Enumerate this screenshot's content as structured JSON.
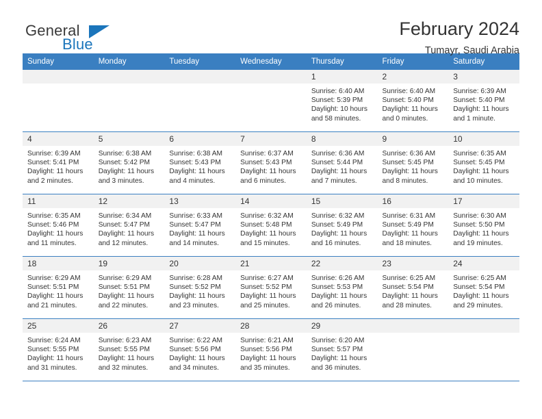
{
  "logo": {
    "word_top": "General",
    "word_bottom": "Blue",
    "accent_color": "#1b75bb",
    "triangle_icon": "triangle-icon"
  },
  "header": {
    "title": "February 2024",
    "subtitle": "Tumayr, Saudi Arabia"
  },
  "theme": {
    "header_band": "#3a7fc1",
    "daynum_band": "#f1f1f1",
    "text": "#333333"
  },
  "weekdays": [
    "Sunday",
    "Monday",
    "Tuesday",
    "Wednesday",
    "Thursday",
    "Friday",
    "Saturday"
  ],
  "weeks": [
    [
      {
        "day": "",
        "empty": true
      },
      {
        "day": "",
        "empty": true
      },
      {
        "day": "",
        "empty": true
      },
      {
        "day": "",
        "empty": true
      },
      {
        "day": "1",
        "sunrise": "Sunrise: 6:40 AM",
        "sunset": "Sunset: 5:39 PM",
        "daylight": "Daylight: 10 hours and 58 minutes."
      },
      {
        "day": "2",
        "sunrise": "Sunrise: 6:40 AM",
        "sunset": "Sunset: 5:40 PM",
        "daylight": "Daylight: 11 hours and 0 minutes."
      },
      {
        "day": "3",
        "sunrise": "Sunrise: 6:39 AM",
        "sunset": "Sunset: 5:40 PM",
        "daylight": "Daylight: 11 hours and 1 minute."
      }
    ],
    [
      {
        "day": "4",
        "sunrise": "Sunrise: 6:39 AM",
        "sunset": "Sunset: 5:41 PM",
        "daylight": "Daylight: 11 hours and 2 minutes."
      },
      {
        "day": "5",
        "sunrise": "Sunrise: 6:38 AM",
        "sunset": "Sunset: 5:42 PM",
        "daylight": "Daylight: 11 hours and 3 minutes."
      },
      {
        "day": "6",
        "sunrise": "Sunrise: 6:38 AM",
        "sunset": "Sunset: 5:43 PM",
        "daylight": "Daylight: 11 hours and 4 minutes."
      },
      {
        "day": "7",
        "sunrise": "Sunrise: 6:37 AM",
        "sunset": "Sunset: 5:43 PM",
        "daylight": "Daylight: 11 hours and 6 minutes."
      },
      {
        "day": "8",
        "sunrise": "Sunrise: 6:36 AM",
        "sunset": "Sunset: 5:44 PM",
        "daylight": "Daylight: 11 hours and 7 minutes."
      },
      {
        "day": "9",
        "sunrise": "Sunrise: 6:36 AM",
        "sunset": "Sunset: 5:45 PM",
        "daylight": "Daylight: 11 hours and 8 minutes."
      },
      {
        "day": "10",
        "sunrise": "Sunrise: 6:35 AM",
        "sunset": "Sunset: 5:45 PM",
        "daylight": "Daylight: 11 hours and 10 minutes."
      }
    ],
    [
      {
        "day": "11",
        "sunrise": "Sunrise: 6:35 AM",
        "sunset": "Sunset: 5:46 PM",
        "daylight": "Daylight: 11 hours and 11 minutes."
      },
      {
        "day": "12",
        "sunrise": "Sunrise: 6:34 AM",
        "sunset": "Sunset: 5:47 PM",
        "daylight": "Daylight: 11 hours and 12 minutes."
      },
      {
        "day": "13",
        "sunrise": "Sunrise: 6:33 AM",
        "sunset": "Sunset: 5:47 PM",
        "daylight": "Daylight: 11 hours and 14 minutes."
      },
      {
        "day": "14",
        "sunrise": "Sunrise: 6:32 AM",
        "sunset": "Sunset: 5:48 PM",
        "daylight": "Daylight: 11 hours and 15 minutes."
      },
      {
        "day": "15",
        "sunrise": "Sunrise: 6:32 AM",
        "sunset": "Sunset: 5:49 PM",
        "daylight": "Daylight: 11 hours and 16 minutes."
      },
      {
        "day": "16",
        "sunrise": "Sunrise: 6:31 AM",
        "sunset": "Sunset: 5:49 PM",
        "daylight": "Daylight: 11 hours and 18 minutes."
      },
      {
        "day": "17",
        "sunrise": "Sunrise: 6:30 AM",
        "sunset": "Sunset: 5:50 PM",
        "daylight": "Daylight: 11 hours and 19 minutes."
      }
    ],
    [
      {
        "day": "18",
        "sunrise": "Sunrise: 6:29 AM",
        "sunset": "Sunset: 5:51 PM",
        "daylight": "Daylight: 11 hours and 21 minutes."
      },
      {
        "day": "19",
        "sunrise": "Sunrise: 6:29 AM",
        "sunset": "Sunset: 5:51 PM",
        "daylight": "Daylight: 11 hours and 22 minutes."
      },
      {
        "day": "20",
        "sunrise": "Sunrise: 6:28 AM",
        "sunset": "Sunset: 5:52 PM",
        "daylight": "Daylight: 11 hours and 23 minutes."
      },
      {
        "day": "21",
        "sunrise": "Sunrise: 6:27 AM",
        "sunset": "Sunset: 5:52 PM",
        "daylight": "Daylight: 11 hours and 25 minutes."
      },
      {
        "day": "22",
        "sunrise": "Sunrise: 6:26 AM",
        "sunset": "Sunset: 5:53 PM",
        "daylight": "Daylight: 11 hours and 26 minutes."
      },
      {
        "day": "23",
        "sunrise": "Sunrise: 6:25 AM",
        "sunset": "Sunset: 5:54 PM",
        "daylight": "Daylight: 11 hours and 28 minutes."
      },
      {
        "day": "24",
        "sunrise": "Sunrise: 6:25 AM",
        "sunset": "Sunset: 5:54 PM",
        "daylight": "Daylight: 11 hours and 29 minutes."
      }
    ],
    [
      {
        "day": "25",
        "sunrise": "Sunrise: 6:24 AM",
        "sunset": "Sunset: 5:55 PM",
        "daylight": "Daylight: 11 hours and 31 minutes."
      },
      {
        "day": "26",
        "sunrise": "Sunrise: 6:23 AM",
        "sunset": "Sunset: 5:55 PM",
        "daylight": "Daylight: 11 hours and 32 minutes."
      },
      {
        "day": "27",
        "sunrise": "Sunrise: 6:22 AM",
        "sunset": "Sunset: 5:56 PM",
        "daylight": "Daylight: 11 hours and 34 minutes."
      },
      {
        "day": "28",
        "sunrise": "Sunrise: 6:21 AM",
        "sunset": "Sunset: 5:56 PM",
        "daylight": "Daylight: 11 hours and 35 minutes."
      },
      {
        "day": "29",
        "sunrise": "Sunrise: 6:20 AM",
        "sunset": "Sunset: 5:57 PM",
        "daylight": "Daylight: 11 hours and 36 minutes."
      },
      {
        "day": "",
        "empty": true
      },
      {
        "day": "",
        "empty": true
      }
    ]
  ]
}
